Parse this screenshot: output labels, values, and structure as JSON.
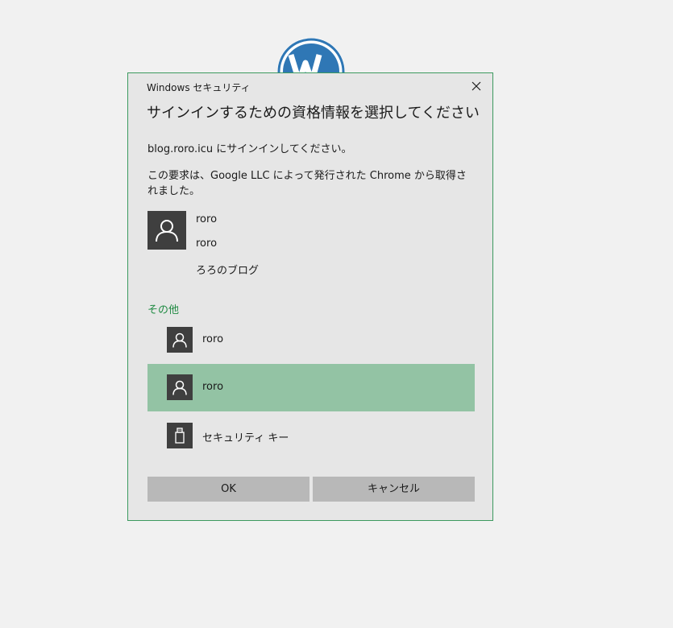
{
  "dialog": {
    "window_title": "Windows セキュリティ",
    "heading": "サインインするための資格情報を選択してください",
    "site_line": "blog.roro.icu にサインインしてください。",
    "request_line": "この要求は、Google LLC によって発行された Chrome から取得されました。"
  },
  "primary_credential": {
    "username": "roro",
    "display_name": "roro",
    "site_name": "ろろのブログ",
    "icon": "user-icon"
  },
  "others": {
    "label": "その他",
    "items": [
      {
        "label": "roro",
        "icon": "user-icon",
        "selected": false
      },
      {
        "label": "roro",
        "icon": "user-icon",
        "selected": true
      },
      {
        "label": "セキュリティ キー",
        "icon": "usb-key-icon",
        "selected": false
      }
    ]
  },
  "buttons": {
    "ok_label": "OK",
    "cancel_label": "キャンセル"
  },
  "colors": {
    "accent_green": "#1f8a42",
    "selected_bg": "#93c3a4",
    "dialog_border": "#3c9a5f",
    "wordpress_blue": "#2f77b5"
  }
}
